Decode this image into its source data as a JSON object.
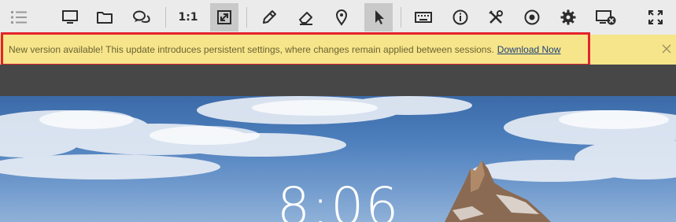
{
  "toolbar": {
    "buttons": [
      {
        "id": "menu",
        "icon": "list-icon"
      },
      {
        "id": "display",
        "icon": "monitor-icon"
      },
      {
        "id": "files",
        "icon": "folder-icon"
      },
      {
        "id": "chat",
        "icon": "chat-icon"
      },
      {
        "id": "scale-1-1",
        "label": "1:1"
      },
      {
        "id": "fit",
        "icon": "resize-icon",
        "active": true
      },
      {
        "id": "draw",
        "icon": "pencil-icon"
      },
      {
        "id": "erase",
        "icon": "eraser-icon"
      },
      {
        "id": "pin",
        "icon": "map-pin-icon"
      },
      {
        "id": "pointer",
        "icon": "cursor-icon",
        "active": true
      },
      {
        "id": "keyboard",
        "icon": "keyboard-icon"
      },
      {
        "id": "info",
        "icon": "info-icon"
      },
      {
        "id": "tools",
        "icon": "tools-icon"
      },
      {
        "id": "record",
        "icon": "record-icon"
      },
      {
        "id": "settings",
        "icon": "gear-icon"
      },
      {
        "id": "disconnect",
        "icon": "disconnect-screen-icon"
      },
      {
        "id": "fullscreen",
        "icon": "fullscreen-icon"
      }
    ],
    "scale_label": "1:1"
  },
  "notice": {
    "message": "New version available! This update introduces persistent settings, where changes remain applied between sessions.",
    "link_label": "Download Now",
    "close_icon": "close-icon"
  },
  "desktop": {
    "clock": "8:06"
  },
  "colors": {
    "toolbar_bg": "#ebebeb",
    "notice_bg": "#f6e58a",
    "highlight_border": "#e3232d",
    "link": "#1c3f7a"
  }
}
